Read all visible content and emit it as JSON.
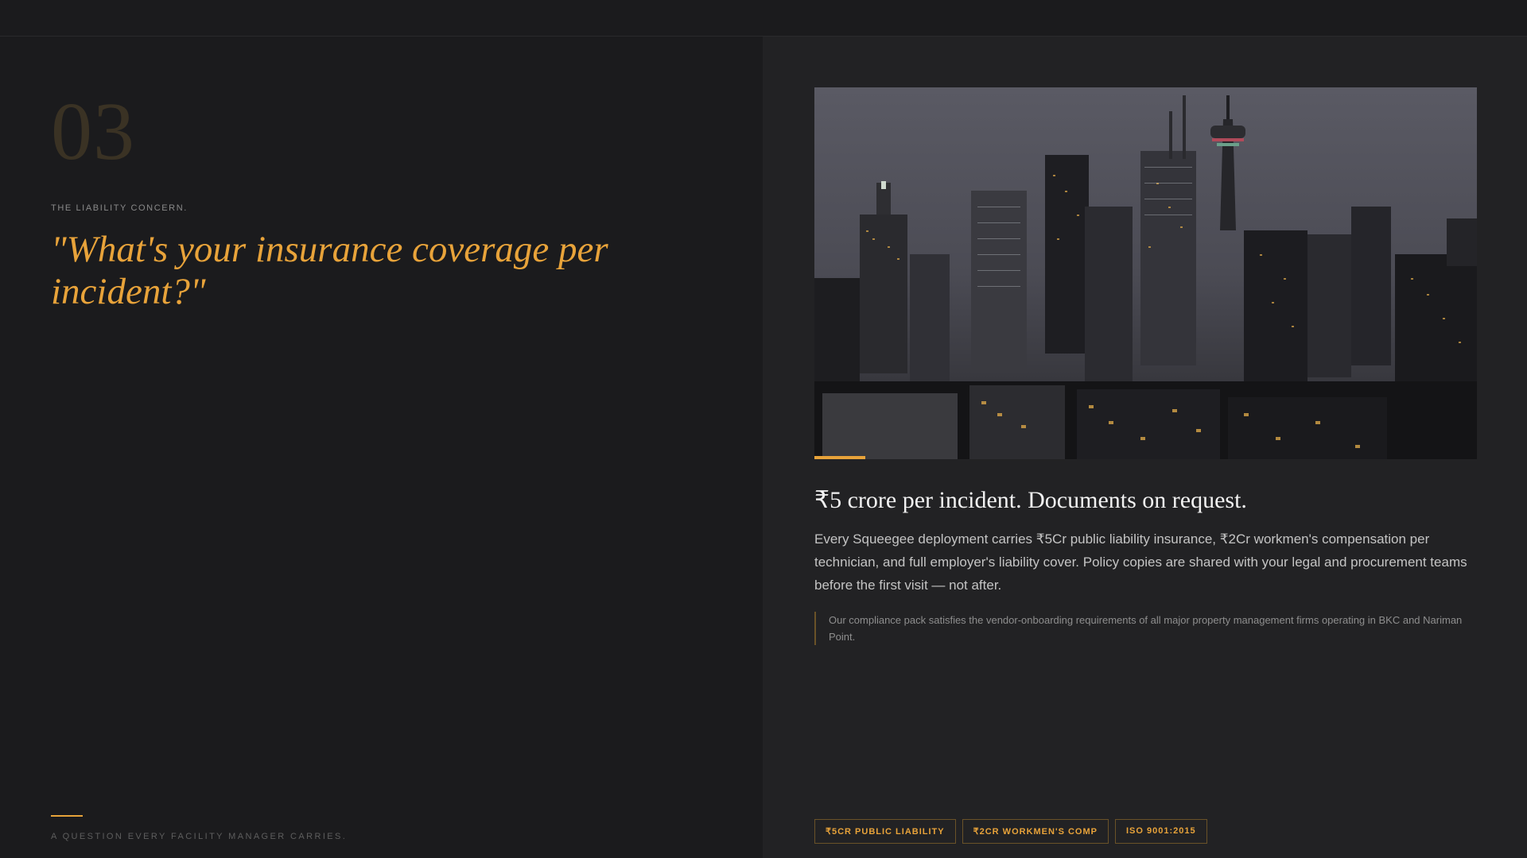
{
  "left": {
    "number": "03",
    "eyebrow": "THE LIABILITY CONCERN.",
    "question": "\"What's your insurance coverage per incident?\"",
    "footer_note": "A QUESTION EVERY FACILITY MANAGER CARRIES."
  },
  "right": {
    "image_alt": "City skyline at dusk",
    "headline": "₹5 crore per incident. Documents on request.",
    "body": "Every Squeegee deployment carries ₹5Cr public liability insurance, ₹2Cr workmen's compensation per technician, and full employer's liability cover. Policy copies are shared with your legal and procurement teams before the first visit — not after.",
    "note": "Our compliance pack satisfies the vendor-onboarding requirements of all major property management firms operating in BKC and Nariman Point.",
    "tags": [
      "₹5CR PUBLIC LIABILITY",
      "₹2CR WORKMEN'S COMP",
      "ISO 9001:2015"
    ]
  },
  "colors": {
    "accent": "#e8a33a",
    "background_left": "#1b1b1d",
    "background_right": "#222224"
  }
}
